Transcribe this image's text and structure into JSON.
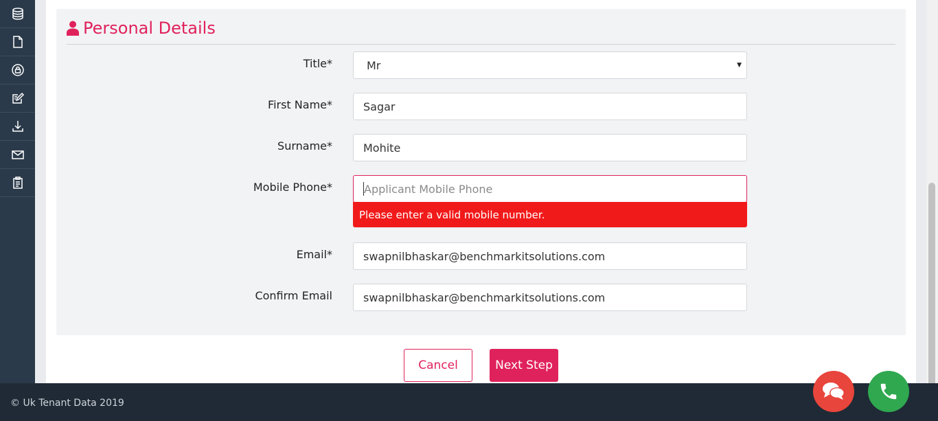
{
  "sidebar": {
    "icons": [
      "database-icon",
      "document-icon",
      "lock-icon",
      "edit-icon",
      "download-icon",
      "mail-icon",
      "clipboard-icon"
    ]
  },
  "section": {
    "title": "Personal Details",
    "icon": "user-icon",
    "accent_color": "#e0225c"
  },
  "form": {
    "title": {
      "label": "Title*",
      "value": "Mr"
    },
    "first_name": {
      "label": "First Name*",
      "value": "Sagar"
    },
    "surname": {
      "label": "Surname*",
      "value": "Mohite"
    },
    "mobile_phone": {
      "label": "Mobile Phone*",
      "value": "",
      "placeholder": "Applicant Mobile Phone",
      "error": "Please enter a valid mobile number."
    },
    "email": {
      "label": "Email*",
      "value": "swapnilbhaskar@benchmarkitsolutions.com"
    },
    "confirm_email": {
      "label": "Confirm Email",
      "value": "swapnilbhaskar@benchmarkitsolutions.com"
    }
  },
  "actions": {
    "cancel_label": "Cancel",
    "next_label": "Next Step"
  },
  "footer": {
    "copyright": "© Uk Tenant Data 2019"
  },
  "fabs": {
    "chat_icon": "chat-icon",
    "chat_color": "#e8453c",
    "phone_icon": "phone-icon",
    "phone_color": "#2fa84f"
  }
}
